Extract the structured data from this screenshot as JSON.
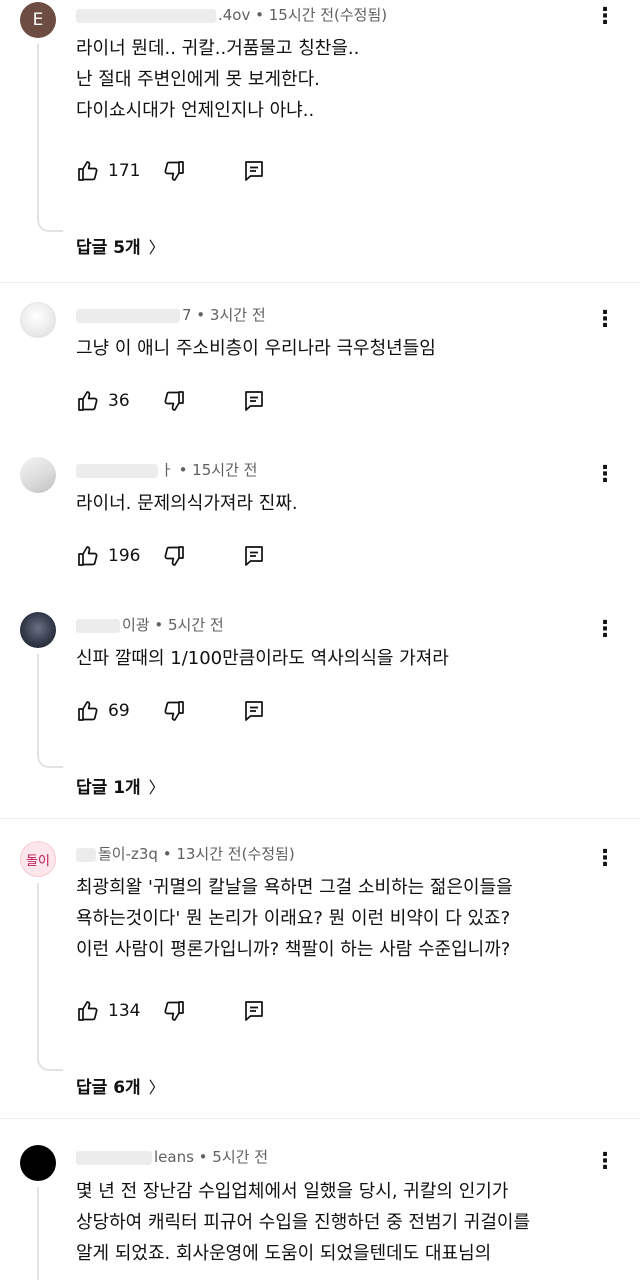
{
  "comments": [
    {
      "avatar_text": "E",
      "meta": ".4ov • 15시간 전(수정됨)",
      "text": "라이너 뭔데.. 귀칼..거품물고 칭찬을..\n난 절대 주변인에게 못 보게한다.\n다이쇼시대가 언제인지나 아냐..",
      "likes": "171",
      "replies": "답글 5개"
    },
    {
      "meta": "7 • 3시간 전",
      "text": "그냥 이 애니 주소비층이 우리나라 극우청년들임",
      "likes": "36"
    },
    {
      "meta": "ㅏ • 15시간 전",
      "text": "라이너. 문제의식가져라 진짜.",
      "likes": "196"
    },
    {
      "meta": "이광 • 5시간 전",
      "text": "신파 깔때의 1/100만큼이라도 역사의식을  가져라",
      "likes": "69",
      "replies": "답글 1개"
    },
    {
      "avatar_text": "돌이",
      "meta": "돌이-z3q • 13시간 전(수정됨)",
      "text": "최광희왈 '귀멸의 칼날을 욕하면 그걸 소비하는 젊은이들을\n욕하는것이다'  뭔 논리가 이래요? 뭔 이런 비약이 다 있죠?\n이런 사람이 평론가입니까?  책팔이 하는 사람 수준입니까?",
      "likes": "134",
      "replies": "답글 6개"
    },
    {
      "meta": "leans • 5시간 전",
      "text": "몇 년 전 장난감 수입업체에서 일했을 당시, 귀칼의 인기가\n상당하여 캐릭터 피규어 수입을 진행하던 중 전범기 귀걸이를\n알게 되었죠. 회사운영에 도움이 되었을텐데도 대표님의"
    }
  ],
  "icons": {
    "more": "more-vert-icon",
    "like": "thumb-up-icon",
    "dislike": "thumb-down-icon",
    "reply": "comment-reply-icon",
    "chevron": "chevron-right-icon"
  },
  "colors": {
    "meta_text": "#606060",
    "thread_line": "#e2e2e2",
    "avatar_e": "#6d4c41",
    "avatar_badge_text": "#c2185b"
  }
}
